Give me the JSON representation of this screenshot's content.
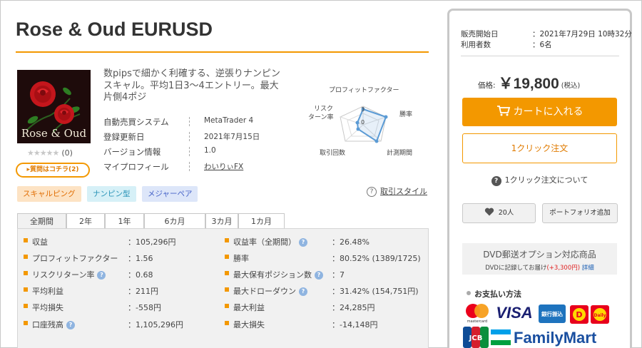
{
  "product": {
    "title": "Rose & Oud EURUSD",
    "thumbnail_label": "Rose & Oud",
    "stars": "★★★★★",
    "review_count": "(0)",
    "question_button": "▸質問はコチラ(2)",
    "description": "数pipsで細かく利確する、逆張りナンピンスキャル。平均1日3〜4エントリー。最大片側4ポジ"
  },
  "info": [
    {
      "key": "自動売買システム",
      "value": "MetaTrader 4"
    },
    {
      "key": "登録更新日",
      "value": "2021年7月15日"
    },
    {
      "key": "バージョン情報",
      "value": "1.0"
    },
    {
      "key": "マイプロフィール",
      "value": "わいりぃFX"
    }
  ],
  "radar": {
    "labels": {
      "profit_factor": "プロフィットファクター",
      "win_rate": "勝率",
      "period": "計測期間",
      "trades": "取引回数",
      "risk_return_1": "リスク",
      "risk_return_2": "ターン率"
    },
    "center_value": "3",
    "level_value": "0",
    "scores": [
      3,
      3.2,
      3.2,
      1.1,
      1.3
    ]
  },
  "tags": [
    "スキャルピング",
    "ナンピン型",
    "メジャーペア"
  ],
  "style_link": {
    "icon": "question-icon",
    "label": "取引スタイル"
  },
  "tabs": [
    "全期間",
    "2年",
    "1年",
    "6カ月",
    "3カ月",
    "1カ月"
  ],
  "stats": {
    "left": [
      {
        "label": "収益",
        "value": "：105,296円",
        "help": false
      },
      {
        "label": "プロフィットファクター",
        "value": "：1.56",
        "help": false
      },
      {
        "label": "リスクリターン率",
        "value": "：0.68",
        "help": true
      },
      {
        "label": "平均利益",
        "value": "：211円",
        "help": false
      },
      {
        "label": "平均損失",
        "value": "：-558円",
        "help": false
      },
      {
        "label": "口座残高",
        "value": "：1,105,296円",
        "help": true
      }
    ],
    "right": [
      {
        "label": "収益率（全期間）",
        "value": "：26.48%",
        "help": true
      },
      {
        "label": "勝率",
        "value": "：80.52% (1389/1725)",
        "help": false
      },
      {
        "label": "最大保有ポジション数",
        "value": "：7",
        "help": true
      },
      {
        "label": "最大ドローダウン",
        "value": "：31.42% (154,751円)",
        "help": true
      },
      {
        "label": "最大利益",
        "value": "：24,285円",
        "help": false
      },
      {
        "label": "最大損失",
        "value": "：-14,148円",
        "help": false
      }
    ],
    "help_glyph": "?"
  },
  "sale": {
    "start_label": "販売開始日",
    "start_value": "：2021年7月29日 10時32分",
    "users_label": "利用者数",
    "users_value": "：6名",
    "price_label": "価格:",
    "price_value": "￥19,800",
    "price_tax": "(税込)",
    "cart_button": "カートに入れる",
    "oneclick_button": "1クリック注文",
    "about_oneclick": "1クリック注文について",
    "favorite_count": "20人",
    "portfolio_button": "ポートフォリオ追加",
    "dvd_title": "DVD郵送オプション対応商品",
    "dvd_note_prefix": "DVDに記録してお届け",
    "dvd_note_price": "(+3,300円)",
    "dvd_note_link": "詳細",
    "payment_title": "お支払い方法",
    "payment_labels": {
      "mastercard": "mastercard",
      "visa": "VISA",
      "bank": "銀行振込",
      "familymart": "FamilyMart",
      "jcb": "JCB",
      "daily": "Daily"
    }
  },
  "colors": {
    "accent": "#f39800",
    "panel_border": "#c8c8c8",
    "stats_bg": "#f1f1f1",
    "radar_blue": "#5b9bd5"
  }
}
